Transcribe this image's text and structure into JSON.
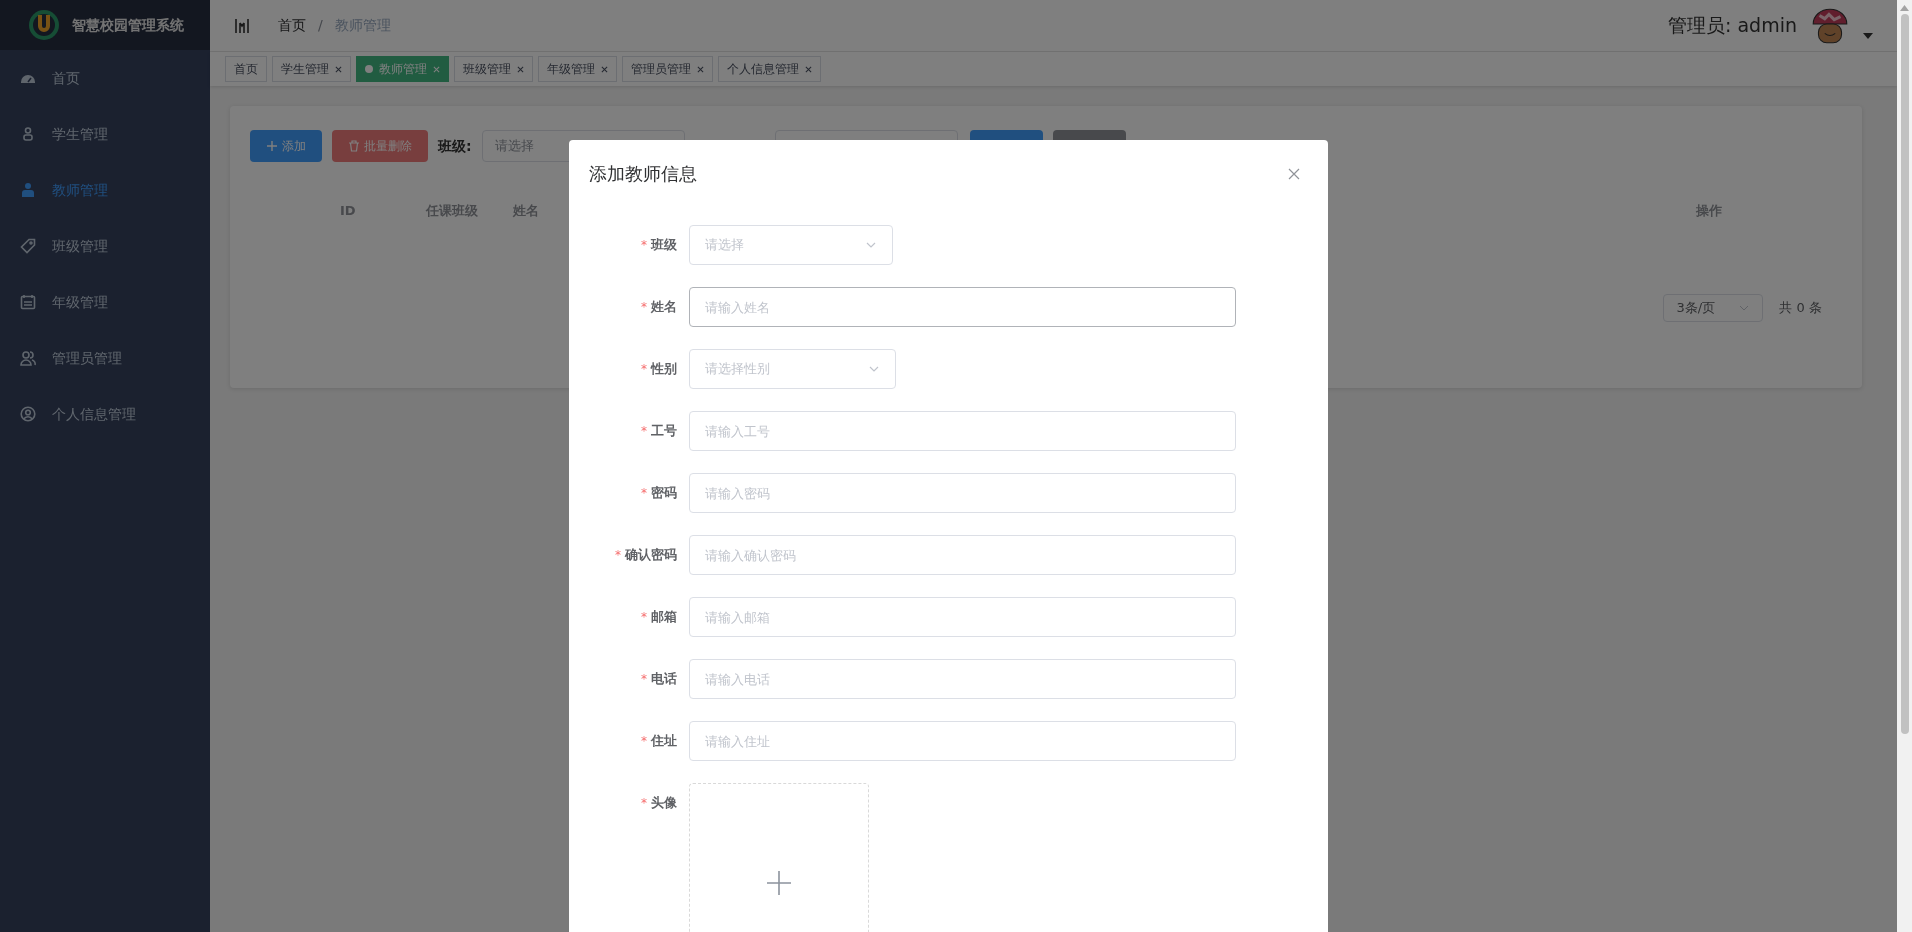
{
  "sidebar": {
    "logo_text": "智慧校园管理系统",
    "items": [
      {
        "label": "首页",
        "selected": false
      },
      {
        "label": "学生管理",
        "selected": false
      },
      {
        "label": "教师管理",
        "selected": true
      },
      {
        "label": "班级管理",
        "selected": false
      },
      {
        "label": "年级管理",
        "selected": false
      },
      {
        "label": "管理员管理",
        "selected": false
      },
      {
        "label": "个人信息管理",
        "selected": false
      }
    ]
  },
  "header": {
    "breadcrumb": [
      "首页",
      "教师管理"
    ],
    "separator": "/",
    "user_label": "管理员: admin"
  },
  "tags": [
    {
      "label": "首页",
      "closable": false,
      "selected": false
    },
    {
      "label": "学生管理",
      "closable": true,
      "selected": false
    },
    {
      "label": "教师管理",
      "closable": true,
      "selected": true
    },
    {
      "label": "班级管理",
      "closable": true,
      "selected": false
    },
    {
      "label": "年级管理",
      "closable": true,
      "selected": false
    },
    {
      "label": "管理员管理",
      "closable": true,
      "selected": false
    },
    {
      "label": "个人信息管理",
      "closable": true,
      "selected": false
    }
  ],
  "toolbar": {
    "add_button": "添加",
    "delete_button": "批量删除",
    "class_label": "班级:",
    "class_placeholder": "请选择"
  },
  "table": {
    "columns": [
      "ID",
      "任课班级",
      "姓名",
      "操作"
    ]
  },
  "pagination": {
    "page_size": "3条/页",
    "total": "共 0 条"
  },
  "dialog": {
    "title": "添加教师信息",
    "fields": [
      {
        "kind": "select",
        "mark": "*",
        "label": "班级",
        "placeholder": "请选择"
      },
      {
        "kind": "input",
        "mark": "*",
        "label": "姓名",
        "placeholder": "请输入姓名",
        "focused": true
      },
      {
        "kind": "select",
        "mark": "*",
        "label": "性别",
        "placeholder": "请选择性别"
      },
      {
        "kind": "input",
        "mark": "*",
        "label": "工号",
        "placeholder": "请输入工号"
      },
      {
        "kind": "input",
        "mark": "*",
        "label": "密码",
        "placeholder": "请输入密码"
      },
      {
        "kind": "input",
        "mark": "*",
        "label": "确认密码",
        "placeholder": "请输入确认密码"
      },
      {
        "kind": "input",
        "mark": "*",
        "label": "邮箱",
        "placeholder": "请输入邮箱"
      },
      {
        "kind": "input",
        "mark": "*",
        "label": "电话",
        "placeholder": "请输入电话"
      },
      {
        "kind": "input",
        "mark": "*",
        "label": "住址",
        "placeholder": "请输入住址"
      },
      {
        "kind": "upload",
        "mark": "*",
        "label": "头像"
      }
    ]
  }
}
